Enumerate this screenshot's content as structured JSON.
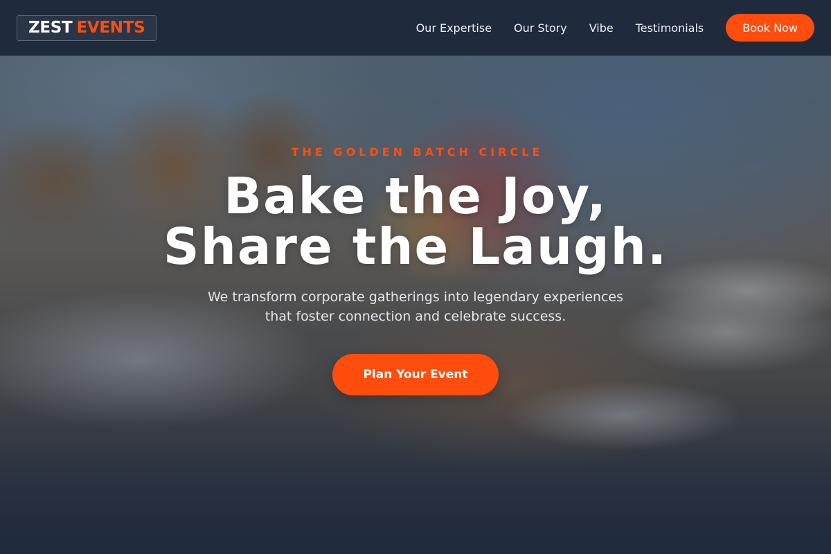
{
  "brand": {
    "word1": "ZEST",
    "word2": "EVENTS",
    "accent_color": "#ff4d0d"
  },
  "nav": {
    "items": [
      {
        "label": "Our Expertise"
      },
      {
        "label": "Our Story"
      },
      {
        "label": "Vibe"
      },
      {
        "label": "Testimonials"
      }
    ],
    "cta_label": "Book Now"
  },
  "hero": {
    "eyebrow": "THE GOLDEN BATCH CIRCLE",
    "headline_line1": "Bake the Joy,",
    "headline_line2": "Share the Laugh.",
    "subtext_line1": "We transform corporate gatherings into legendary experiences",
    "subtext_line2": "that foster connection and celebrate success.",
    "cta_label": "Plan Your Event"
  }
}
